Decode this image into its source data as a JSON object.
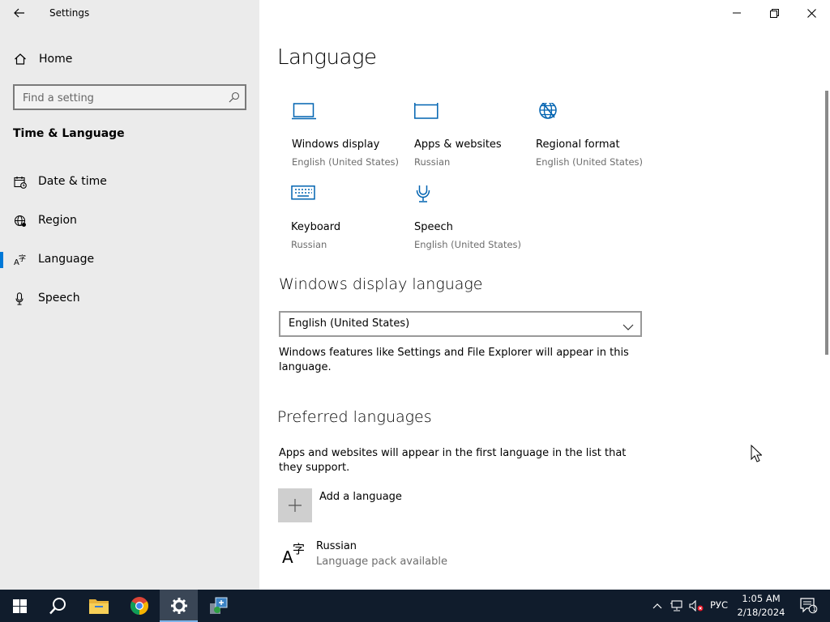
{
  "window": {
    "title": "Settings"
  },
  "sidebar": {
    "home_label": "Home",
    "search_placeholder": "Find a setting",
    "section_title": "Time & Language",
    "items": [
      {
        "label": "Date & time",
        "icon": "calendar-clock-icon"
      },
      {
        "label": "Region",
        "icon": "globe-icon"
      },
      {
        "label": "Language",
        "icon": "language-icon",
        "active": true
      },
      {
        "label": "Speech",
        "icon": "microphone-icon"
      }
    ]
  },
  "main": {
    "title": "Language",
    "tiles": [
      {
        "name": "Windows display",
        "sub": "English (United States)",
        "icon": "monitor-icon"
      },
      {
        "name": "Apps & websites",
        "sub": "Russian",
        "icon": "browser-window-icon"
      },
      {
        "name": "Regional format",
        "sub": "English (United States)",
        "icon": "globe-format-icon"
      },
      {
        "name": "Keyboard",
        "sub": "Russian",
        "icon": "keyboard-icon"
      },
      {
        "name": "Speech",
        "sub": "English (United States)",
        "icon": "microphone-icon"
      }
    ],
    "display_language": {
      "heading": "Windows display language",
      "selected": "English (United States)",
      "description": "Windows features like Settings and File Explorer will appear in this language."
    },
    "preferred": {
      "heading": "Preferred languages",
      "description": "Apps and websites will appear in the first language in the list that they support.",
      "add_label": "Add a language",
      "languages": [
        {
          "name": "Russian",
          "status": "Language pack available"
        }
      ]
    }
  },
  "taskbar": {
    "input_language": "РУС",
    "time": "1:05 AM",
    "date": "2/18/2024",
    "notification_count": "1"
  },
  "colors": {
    "accent": "#0078d7",
    "sidebar_bg": "#ebebeb",
    "taskbar_bg": "#101c2c"
  }
}
